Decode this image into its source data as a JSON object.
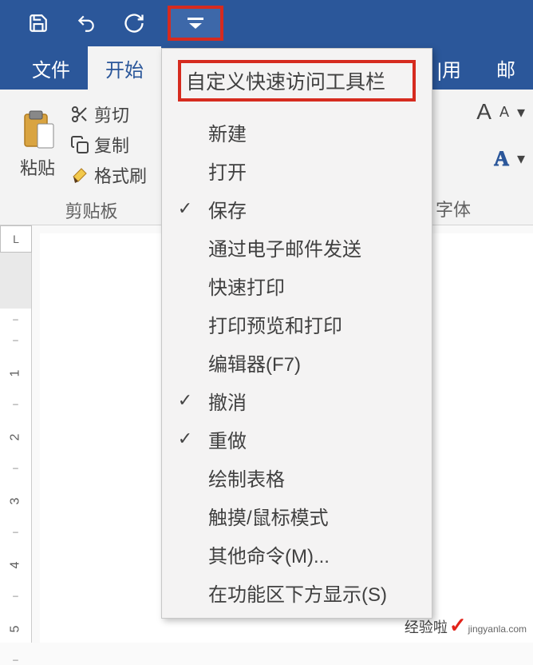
{
  "qat": {
    "save": "save-icon",
    "undo": "undo-icon",
    "redo": "redo-icon"
  },
  "tabs": {
    "file": "文件",
    "home": "开始",
    "ref_partial": "|用",
    "mail_partial": "邮"
  },
  "clipboard": {
    "paste": "粘贴",
    "cut": "剪切",
    "copy": "复制",
    "format_painter": "格式刷",
    "group_label": "剪贴板"
  },
  "font": {
    "aa_large": "A",
    "aa_small": "A",
    "clear": "A",
    "outline_a": "A",
    "group_label": "字体"
  },
  "ruler": {
    "corner": "L",
    "marks": [
      "1",
      "2",
      "3",
      "4",
      "5"
    ]
  },
  "dropdown": {
    "title": "自定义快速访问工具栏",
    "items": [
      {
        "label": "新建",
        "checked": false
      },
      {
        "label": "打开",
        "checked": false
      },
      {
        "label": "保存",
        "checked": true
      },
      {
        "label": "通过电子邮件发送",
        "checked": false
      },
      {
        "label": "快速打印",
        "checked": false
      },
      {
        "label": "打印预览和打印",
        "checked": false
      },
      {
        "label": "编辑器(F7)",
        "checked": false
      },
      {
        "label": "撤消",
        "checked": true
      },
      {
        "label": "重做",
        "checked": true
      },
      {
        "label": "绘制表格",
        "checked": false
      },
      {
        "label": "触摸/鼠标模式",
        "checked": false
      },
      {
        "label": "其他命令(M)...",
        "checked": false
      },
      {
        "label": "在功能区下方显示(S)",
        "checked": false
      }
    ]
  },
  "watermark": {
    "cn": "经验啦",
    "url": "jingyanla.com"
  }
}
